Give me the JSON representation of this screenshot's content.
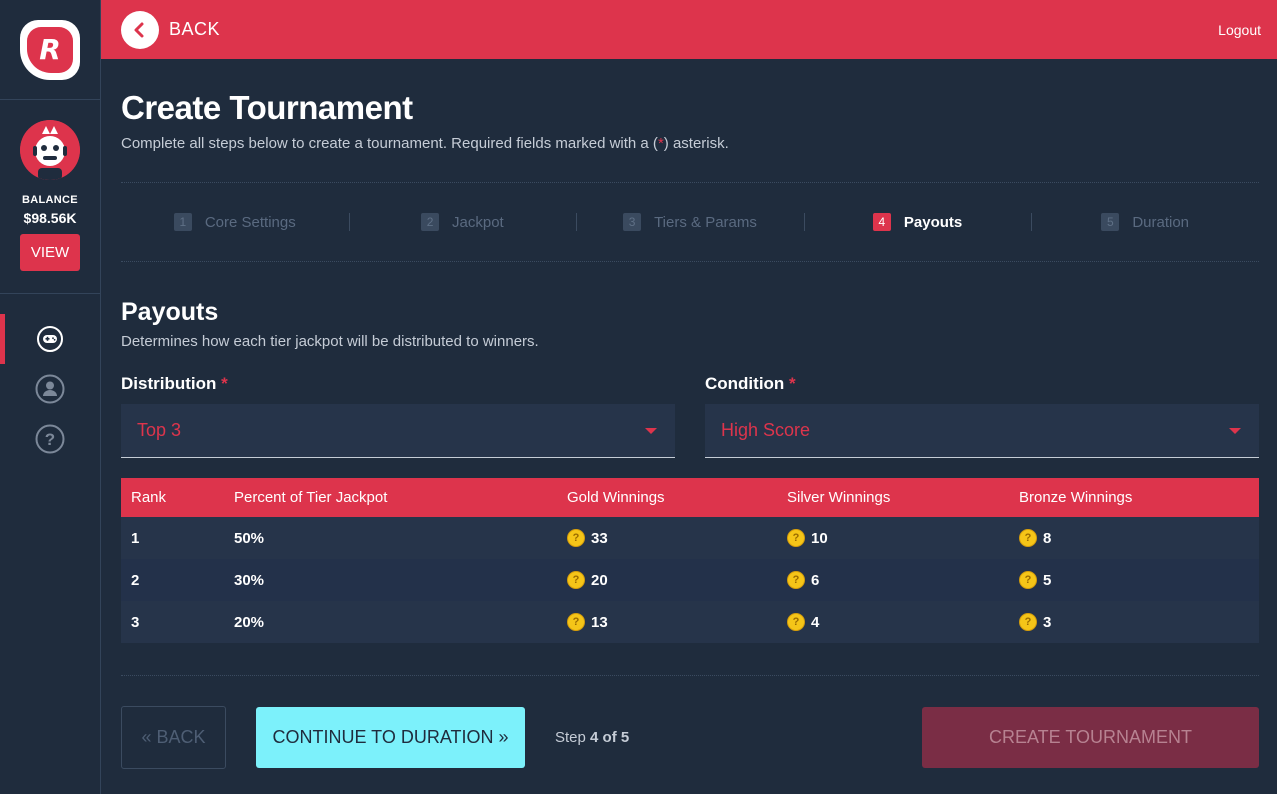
{
  "sidebar": {
    "logo": "R",
    "balance_label": "BALANCE",
    "balance_value": "$98.56K",
    "view_label": "VIEW",
    "nav": [
      {
        "icon": "gamepad-icon",
        "active": true
      },
      {
        "icon": "user-icon",
        "active": false
      },
      {
        "icon": "help-icon",
        "active": false
      }
    ]
  },
  "topbar": {
    "back_label": "BACK",
    "logout_label": "Logout",
    "color": "#dd344c"
  },
  "page": {
    "title": "Create Tournament",
    "subtitle_pre": "Complete all steps below to create a tournament. Required fields marked with a (",
    "subtitle_ast": "*",
    "subtitle_post": ") asterisk."
  },
  "steps": [
    {
      "num": "1",
      "label": "Core Settings",
      "active": false
    },
    {
      "num": "2",
      "label": "Jackpot",
      "active": false
    },
    {
      "num": "3",
      "label": "Tiers & Params",
      "active": false
    },
    {
      "num": "4",
      "label": "Payouts",
      "active": true
    },
    {
      "num": "5",
      "label": "Duration",
      "active": false
    }
  ],
  "section": {
    "title": "Payouts",
    "subtitle": "Determines how each tier jackpot will be distributed to winners."
  },
  "fields": {
    "distribution": {
      "label": "Distribution",
      "required": "*",
      "value": "Top 3"
    },
    "condition": {
      "label": "Condition",
      "required": "*",
      "value": "High Score"
    }
  },
  "table": {
    "headers": [
      "Rank",
      "Percent of Tier Jackpot",
      "Gold Winnings",
      "Silver Winnings",
      "Bronze Winnings"
    ],
    "rows": [
      {
        "rank": "1",
        "percent": "50%",
        "gold": "33",
        "silver": "10",
        "bronze": "8"
      },
      {
        "rank": "2",
        "percent": "30%",
        "gold": "20",
        "silver": "6",
        "bronze": "5"
      },
      {
        "rank": "3",
        "percent": "20%",
        "gold": "13",
        "silver": "4",
        "bronze": "3"
      }
    ]
  },
  "actions": {
    "back_label": "« BACK",
    "continue_label": "CONTINUE TO DURATION »",
    "step_pre": "Step ",
    "step_current": "4 of 5",
    "create_label": "CREATE TOURNAMENT"
  }
}
